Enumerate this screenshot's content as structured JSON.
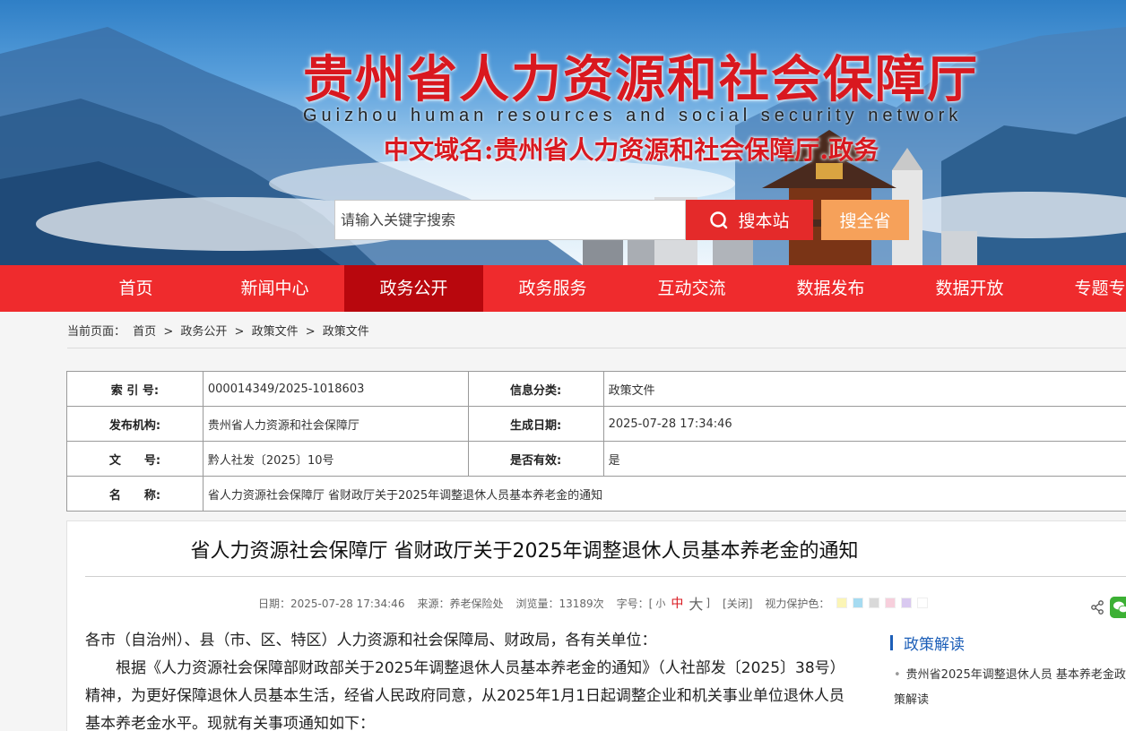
{
  "header": {
    "title": "贵州省人力资源和社会保障厅",
    "subtitle": "Guizhou human resources and social security network",
    "domain": "中文域名:贵州省人力资源和社会保障厅.政务"
  },
  "search": {
    "placeholder": "请输入关键字搜索",
    "site_button": "搜本站",
    "all_button": "搜全省"
  },
  "nav": {
    "items": [
      "首页",
      "新闻中心",
      "政务公开",
      "政务服务",
      "互动交流",
      "数据发布",
      "数据开放",
      "专题专栏"
    ],
    "active": "政务公开"
  },
  "breadcrumb": {
    "label": "当前页面：",
    "items": [
      "首页",
      "政务公开",
      "政策文件",
      "政策文件"
    ],
    "sep": ">"
  },
  "info": {
    "index_label": "索 引 号:",
    "index_value": "000014349/2025-1018603",
    "category_label": "信息分类:",
    "category_value": "政策文件",
    "publisher_label": "发布机构:",
    "publisher_value": "贵州省人力资源和社会保障厅",
    "date_label": "生成日期:",
    "date_value": "2025-07-28 17:34:46",
    "docno_label": "文　　号:",
    "docno_value": "黔人社发〔2025〕10号",
    "valid_label": "是否有效:",
    "valid_value": "是",
    "name_label": "名　　称:",
    "name_value": "省人力资源社会保障厅 省财政厅关于2025年调整退休人员基本养老金的通知"
  },
  "article": {
    "title": "省人力资源社会保障厅 省财政厅关于2025年调整退休人员基本养老金的通知",
    "meta": {
      "date": "日期：2025-07-28 17:34:46",
      "source": "来源：养老保险处",
      "views": "浏览量：13189次",
      "font_label": "字号：[",
      "font_small": "小",
      "font_medium": "中",
      "font_large": "大",
      "font_close": "]",
      "close": "[关闭]",
      "eye_label": "视力保护色："
    },
    "swatches": [
      "#fbf5b6",
      "#a6dbf1",
      "#d9d9d9",
      "#f7cfdc",
      "#d9c9f0",
      "#ffffff"
    ],
    "salutation": "各市（自治州）、县（市、区、特区）人力资源和社会保障局、财政局，各有关单位：",
    "paragraph": "根据《人力资源社会保障部财政部关于2025年调整退休人员基本养老金的通知》（人社部发〔2025〕38号）精神，为更好保障退休人员基本生活，经省人民政府同意，从2025年1月1日起调整企业和机关事业单位退休人员基本养老金水平。现就有关事项通知如下："
  },
  "sidebar": {
    "heading": "政策解读",
    "link": "贵州省2025年调整退休人员 基本养老金政策解读"
  },
  "colors": {
    "brand_red": "#ef2b2d",
    "active_red": "#b8070d",
    "search_orange": "#f6a15a",
    "link_blue": "#1d5fb8"
  }
}
